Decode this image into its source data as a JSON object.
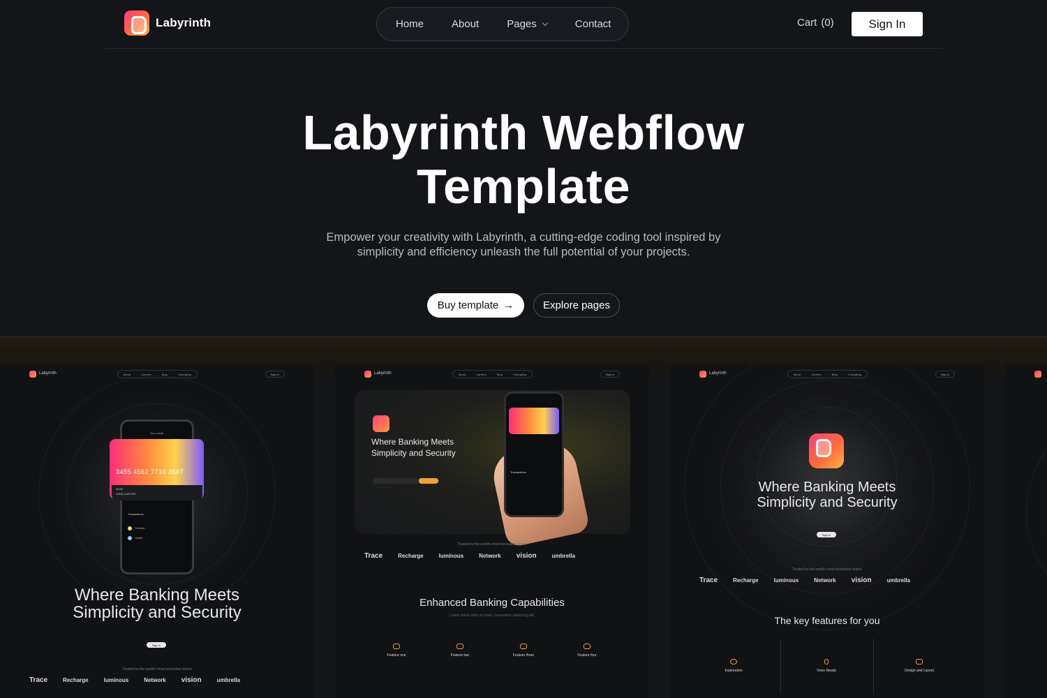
{
  "nav": {
    "brand": "Labyrinth",
    "menu": [
      {
        "label": "Home"
      },
      {
        "label": "About"
      },
      {
        "label": "Pages",
        "has_dropdown": true
      },
      {
        "label": "Contact"
      }
    ],
    "cart_label": "Cart",
    "cart_count": "(0)",
    "signin_label": "Sign In"
  },
  "hero": {
    "title": "Labyrinth Webflow Template",
    "subtitle": "Empower your creativity with Labyrinth, a cutting-edge coding tool inspired by simplicity and efficiency unleash the full potential of your projects.",
    "buy_label": "Buy template",
    "buy_icon": "arrow-right-icon",
    "explore_label": "Explore pages"
  },
  "showcase": {
    "mini_brand": "Labyrinth",
    "mini_menu": [
      "About",
      "Careers",
      "Blog",
      "Changelog"
    ],
    "mini_signin": "Sign in",
    "headline_line1": "Where Banking Meets",
    "headline_line2": "Simplicity and Security",
    "card_number": "3455 4562 7710 3507",
    "card_expiry": "02/30",
    "card_holder": "JOHN CARTER",
    "transactions_label": "Transactions",
    "trusted_text": "Trusted by the world's most innovative teams",
    "logos": [
      "Trace",
      "Recharge",
      "luminous",
      "Network",
      "vision",
      "umbrella"
    ],
    "card2_section_title": "Enhanced Banking Capabilities",
    "card2_features": [
      "Feature one",
      "Feature two",
      "Feature three",
      "Feature four"
    ],
    "card3_section_title": "The key features for you",
    "card3_features": [
      "Exploration",
      "Voice Ready",
      "Design and Layout"
    ],
    "accent_color": "#f0a13a",
    "gradient_colors": [
      "#ff2d7a",
      "#ff8a3d",
      "#ffd34d",
      "#7b5cff"
    ]
  }
}
